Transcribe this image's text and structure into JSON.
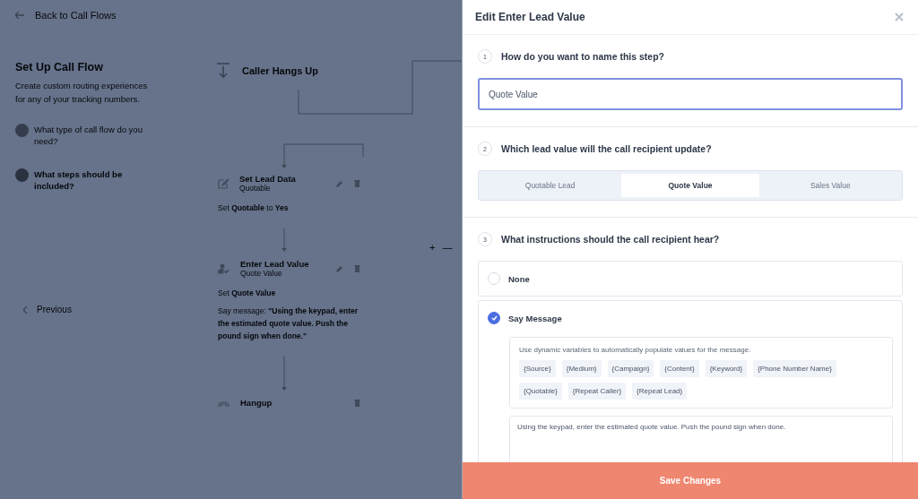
{
  "background": {
    "back_link": "Back to Call Flows",
    "title": "Set Up Call Flow",
    "description": "Create custom routing experiences for any of your tracking numbers.",
    "steps": [
      {
        "label": "What type of call flow do you need?",
        "selected": false
      },
      {
        "label": "What steps should be included?",
        "selected": true
      }
    ],
    "previous": "Previous",
    "zoom_controls": [
      "+",
      "—"
    ],
    "flow": {
      "trigger": "Caller Hangs Up",
      "nodes": [
        {
          "kind": "lead-data",
          "title": "Set Lead Data",
          "subtitle": "Quotable",
          "details": [
            "Set **Quotable** to **Yes**"
          ]
        },
        {
          "kind": "lead-value",
          "title": "Enter Lead Value",
          "subtitle": "Quote Value",
          "details": [
            "Set **Quote Value**",
            "Say message: **\"Using the keypad, enter the estimated quote value. Push the pound sign when done.\"**"
          ]
        },
        {
          "kind": "hangup",
          "title": "Hangup"
        }
      ]
    }
  },
  "panel": {
    "title": "Edit Enter Lead Value",
    "name_step": {
      "number": "1",
      "question": "How do you want to name this step?",
      "value": "Quote Value"
    },
    "lead_value": {
      "number": "2",
      "question": "Which lead value will the call recipient update?",
      "options": [
        {
          "label": "Quotable Lead",
          "selected": false
        },
        {
          "label": "Quote Value",
          "selected": true
        },
        {
          "label": "Sales Value",
          "selected": false
        }
      ]
    },
    "instructions": {
      "number": "3",
      "question": "What instructions should the call recipient hear?",
      "options": [
        {
          "label": "None",
          "selected": false
        },
        {
          "label": "Say Message",
          "selected": true
        }
      ],
      "hint": "Use dynamic variables to automatically populate values for the message.",
      "variables": [
        "{Source}",
        "{Medium}",
        "{Campaign}",
        "{Content}",
        "{Keyword}",
        "{Phone Number Name}",
        "{Quotable}",
        "{Repeat Caller}",
        "{Repeat Lead}"
      ],
      "message": "Using the keypad, enter the estimated quote value. Push the pound sign when done."
    },
    "save_button": "Save Changes"
  }
}
